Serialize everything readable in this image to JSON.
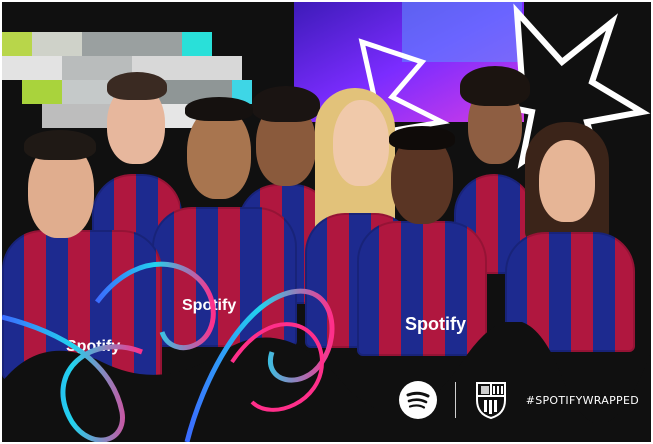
{
  "footer": {
    "hashtag": "#SPOTIFYWRAPPED",
    "spotify_icon": "spotify-logo",
    "club_icon": "fcb-crest"
  },
  "jersey_sponsor": "Spotify",
  "colors": {
    "background": "#101010",
    "barca_blue": "#1d2a8f",
    "barca_red": "#b0173f",
    "neon_blue": "#3b6bff",
    "neon_pink": "#ff2f8a",
    "accent_purple": "#7b2cff"
  }
}
